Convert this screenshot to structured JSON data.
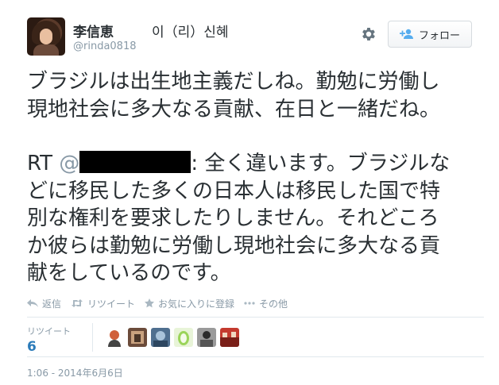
{
  "user": {
    "fullname": "李信恵",
    "korean_name": "이（리）신혜",
    "username": "@rinda0818"
  },
  "follow_button": {
    "label": "フォロー"
  },
  "tweet": {
    "line1": "ブラジルは出生地主義だしね。勤勉に労働し",
    "line2": "現地社会に多大なる貢献、在日と一緒だね。",
    "rt_prefix": " RT ",
    "rt_mention": "@",
    "rt_after_redact": ": 全く違います。ブラジルな",
    "line4": "どに移民した多くの日本人は移民した国で特",
    "line5": "別な権利を要求したりしません。それどころ",
    "line6": "か彼らは勤勉に労働し現地社会に多大なる貢",
    "line7": "献をしているのです。"
  },
  "actions": {
    "reply": "返信",
    "retweet": "リツイート",
    "favorite": "お気に入りに登録",
    "more": "その他"
  },
  "stats": {
    "retweets_label": "リツイート",
    "retweets_count": "6"
  },
  "retweeter_avatars": [
    "avatar-1",
    "avatar-2",
    "avatar-3",
    "avatar-4",
    "avatar-5",
    "avatar-6"
  ],
  "timestamp": "1:06 - 2014年6月6日",
  "colors": {
    "text": "#292f33",
    "muted": "#8899a6",
    "link": "#2b7bb9",
    "border": "#e1e8ed"
  }
}
